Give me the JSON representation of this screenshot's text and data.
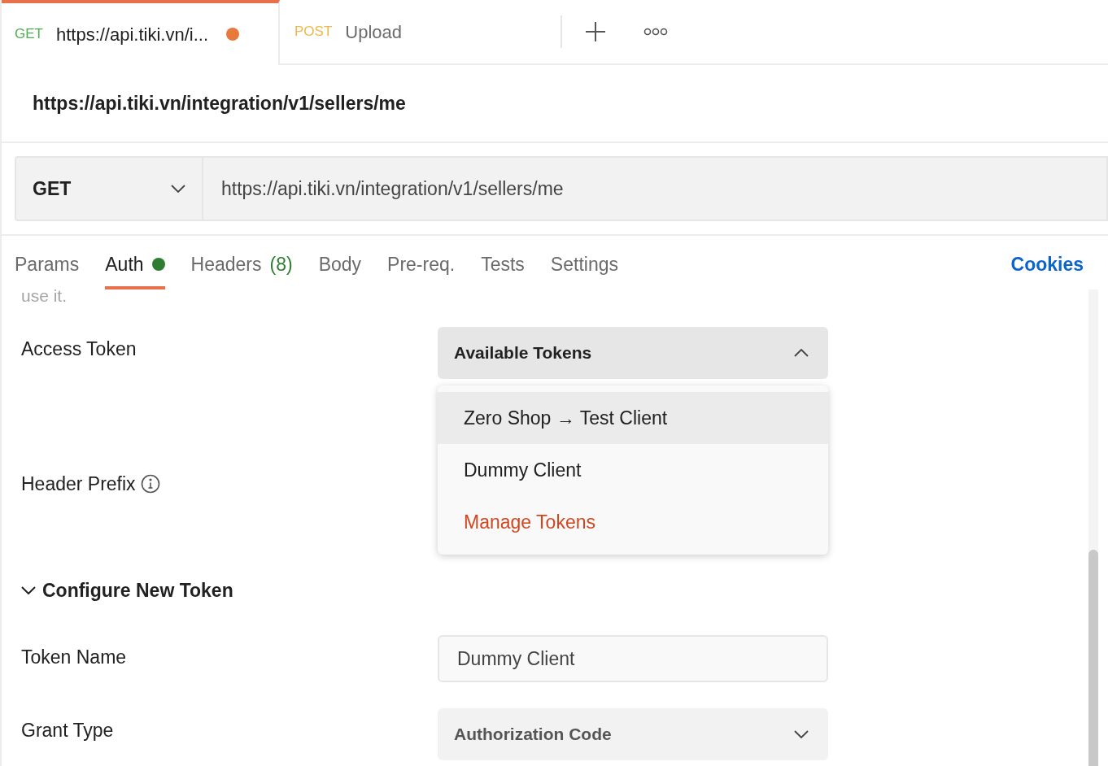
{
  "request_tabs": [
    {
      "method": "GET",
      "title": "https://api.tiki.vn/i...",
      "selected": true,
      "unsaved": true
    },
    {
      "method": "POST",
      "title": "Upload",
      "selected": false,
      "unsaved": false
    }
  ],
  "request_title": "https://api.tiki.vn/integration/v1/sellers/me",
  "method_select": {
    "value": "GET"
  },
  "url": {
    "value": "https://api.tiki.vn/integration/v1/sellers/me"
  },
  "section_tabs": [
    {
      "label": "Params",
      "selected": false,
      "indicator": false
    },
    {
      "label": "Auth",
      "selected": true,
      "indicator": true
    },
    {
      "label": "Headers",
      "count": "(8)",
      "selected": false,
      "indicator": false
    },
    {
      "label": "Body",
      "selected": false,
      "indicator": false
    },
    {
      "label": "Pre-req.",
      "selected": false,
      "indicator": false
    },
    {
      "label": "Tests",
      "selected": false,
      "indicator": false
    },
    {
      "label": "Settings",
      "selected": false,
      "indicator": false
    }
  ],
  "cookies_link": "Cookies",
  "clipped_text": "use it.",
  "access_token": {
    "label": "Access Token",
    "dropdown": {
      "value": "Available Tokens",
      "expanded": true
    },
    "menu": [
      {
        "kind": "token",
        "label": "Zero Shop → Test Client",
        "highlighted": true
      },
      {
        "kind": "token",
        "label": "Dummy Client",
        "highlighted": false
      },
      {
        "kind": "action",
        "label": "Manage Tokens",
        "highlighted": false
      }
    ]
  },
  "header_prefix": {
    "label": "Header Prefix"
  },
  "configure_section": {
    "title": "Configure New Token",
    "expanded": true
  },
  "token_name": {
    "label": "Token Name",
    "value": "Dummy Client"
  },
  "grant_type": {
    "label": "Grant Type",
    "value": "Authorization Code"
  }
}
